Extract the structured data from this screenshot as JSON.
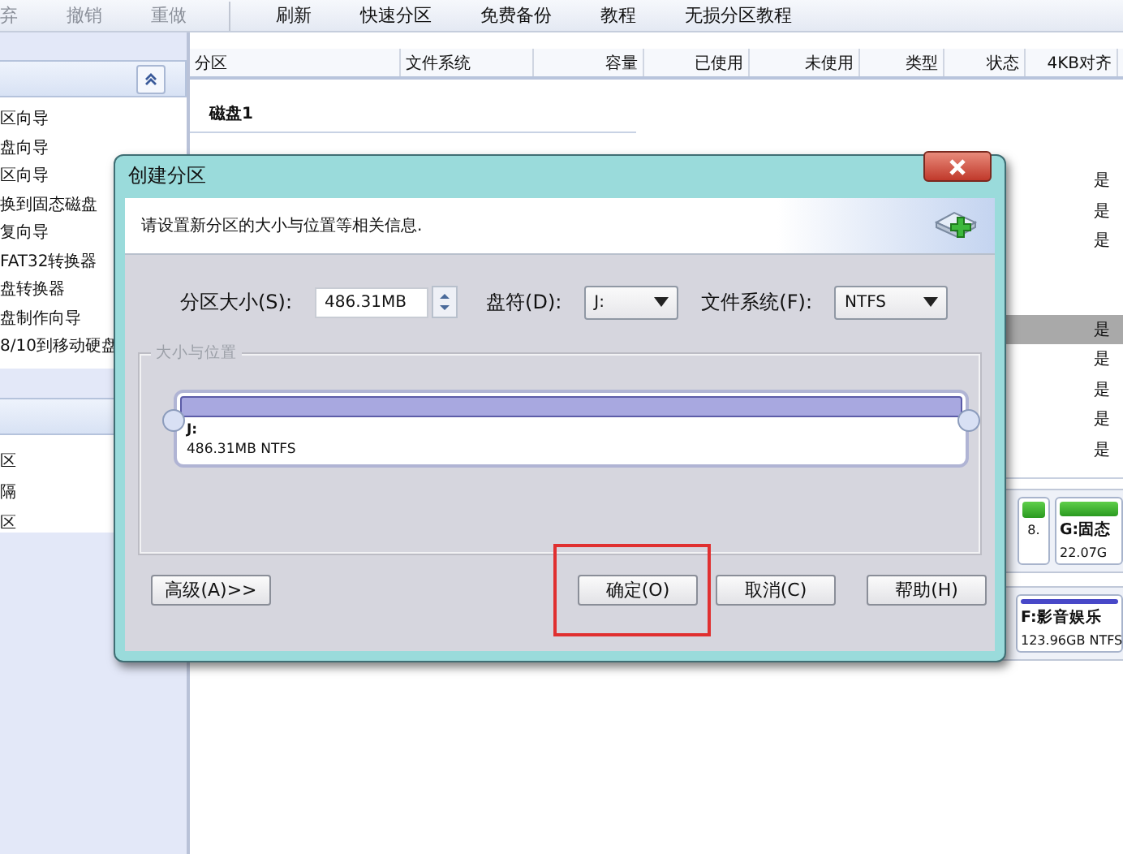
{
  "toolbar": [
    {
      "label": "弃",
      "disabled": true
    },
    {
      "label": "撤销",
      "disabled": true
    },
    {
      "label": "重做",
      "disabled": true
    },
    {
      "label": "刷新",
      "disabled": false
    },
    {
      "label": "快速分区",
      "disabled": false
    },
    {
      "label": "免费备份",
      "disabled": false
    },
    {
      "label": "教程",
      "disabled": false
    },
    {
      "label": "无损分区教程",
      "disabled": false
    }
  ],
  "sidebar": {
    "panels": [
      {
        "items": [
          "区向导",
          "盘向导",
          "区向导",
          "换到固态磁盘",
          "复向导",
          "FAT32转换器",
          "盘转换器",
          "盘制作向导",
          "8/10到移动硬盘"
        ]
      },
      {
        "items": [
          "区",
          "隔",
          "区"
        ]
      }
    ]
  },
  "table": {
    "columns": [
      "分区",
      "文件系统",
      "容量",
      "已使用",
      "未使用",
      "类型",
      "状态",
      "4KB对齐"
    ],
    "disk_label": "磁盘1",
    "groups": [
      {
        "rows": [
          {
            "align_4kb": "是",
            "selected": false
          },
          {
            "align_4kb": "是",
            "selected": false
          },
          {
            "align_4kb": "是",
            "selected": false
          }
        ]
      },
      {
        "rows": [
          {
            "align_4kb": "是",
            "selected": true
          },
          {
            "align_4kb": "是",
            "selected": false
          },
          {
            "align_4kb": "是",
            "selected": false
          },
          {
            "align_4kb": "是",
            "selected": false
          },
          {
            "align_4kb": "是",
            "selected": false
          }
        ]
      }
    ]
  },
  "disk_map": [
    {
      "partitions": [
        {
          "kind": "small",
          "size": "8."
        },
        {
          "kind": "named",
          "name": "G:固态",
          "size": "22.07G"
        }
      ]
    },
    {
      "partitions": [
        {
          "kind": "named",
          "name": "F:影音娱乐",
          "size": "123.96GB NTFS"
        }
      ]
    }
  ],
  "dialog": {
    "title": "创建分区",
    "description": "请设置新分区的大小与位置等相关信息.",
    "size_label": "分区大小(S):",
    "size_value": "486.31MB",
    "drive_label": "盘符(D):",
    "drive_value": "J:",
    "fs_label": "文件系统(F):",
    "fs_value": "NTFS",
    "group_label": "大小与位置",
    "partition": {
      "letter": "J:",
      "detail": "486.31MB NTFS"
    },
    "buttons": [
      {
        "label": "高级(A)>>"
      },
      {
        "label": "确定(O)"
      },
      {
        "label": "取消(C)"
      },
      {
        "label": "帮助(H)"
      }
    ],
    "confirm_highlighted": true
  }
}
